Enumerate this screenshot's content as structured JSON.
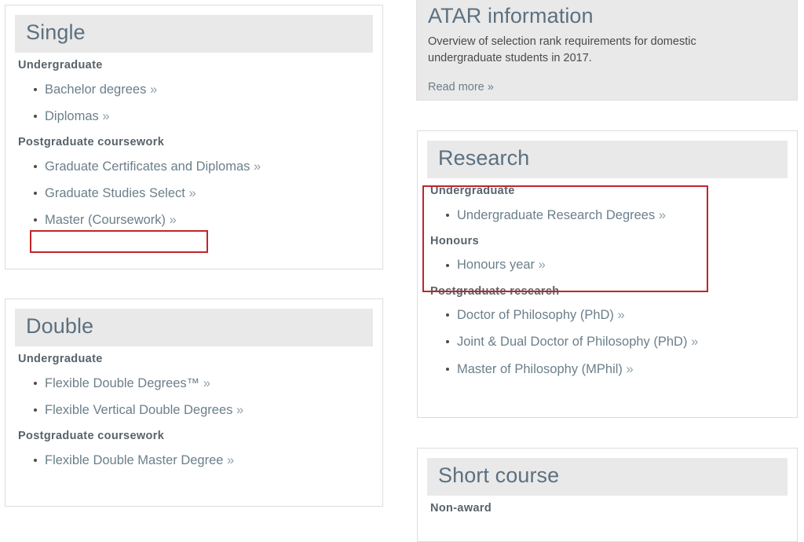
{
  "cards": {
    "single": {
      "title": "Single",
      "groups": [
        {
          "heading": "Undergraduate",
          "items": [
            {
              "label": "Bachelor degrees",
              "chevron": "»"
            },
            {
              "label": "Diplomas",
              "chevron": "»"
            }
          ]
        },
        {
          "heading": "Postgraduate coursework",
          "items": [
            {
              "label": "Graduate Certificates and Diplomas",
              "chevron": "»"
            },
            {
              "label": "Graduate Studies Select",
              "chevron": "»"
            },
            {
              "label": "Master (Coursework)",
              "chevron": "»"
            }
          ]
        }
      ]
    },
    "double": {
      "title": "Double",
      "groups": [
        {
          "heading": "Undergraduate",
          "items": [
            {
              "label": "Flexible Double Degrees™",
              "chevron": "»"
            },
            {
              "label": "Flexible Vertical Double Degrees",
              "chevron": "»"
            }
          ]
        },
        {
          "heading": "Postgraduate coursework",
          "items": [
            {
              "label": "Flexible Double Master Degree",
              "chevron": "»"
            }
          ]
        }
      ]
    },
    "atar": {
      "title": "ATAR information",
      "blurb": "Overview of selection rank requirements for domestic undergraduate students in 2017.",
      "read_more": "Read more »"
    },
    "research": {
      "title": "Research",
      "groups": [
        {
          "heading": "Undergraduate",
          "items": [
            {
              "label": "Undergraduate Research Degrees",
              "chevron": "»"
            }
          ]
        },
        {
          "heading": "Honours",
          "items": [
            {
              "label": "Honours year",
              "chevron": "»"
            }
          ]
        },
        {
          "heading": "Postgraduate research",
          "items": [
            {
              "label": "Doctor of Philosophy (PhD)",
              "chevron": "»"
            },
            {
              "label": "Joint & Dual Doctor of Philosophy (PhD)",
              "chevron": "»"
            },
            {
              "label": "Master of Philosophy (MPhil)",
              "chevron": "»"
            }
          ]
        }
      ]
    },
    "shortcourse": {
      "title": "Short course",
      "groups": [
        {
          "heading": "Non-award",
          "items": []
        }
      ]
    }
  },
  "annotations": [
    {
      "name": "master-coursework-highlight",
      "target": "Master (Coursework) »",
      "color": "#c0252c"
    },
    {
      "name": "research-undergraduate-honours-highlight",
      "target": "Undergraduate / Honours block",
      "color": "#c0252c"
    }
  ],
  "colors": {
    "heading_text": "#5c7080",
    "link_text": "#6b7f8a",
    "section_text": "#57636b",
    "header_bar": "#e9e9e9",
    "card_border": "#dcdcdc",
    "annotation": "#c0252c"
  }
}
